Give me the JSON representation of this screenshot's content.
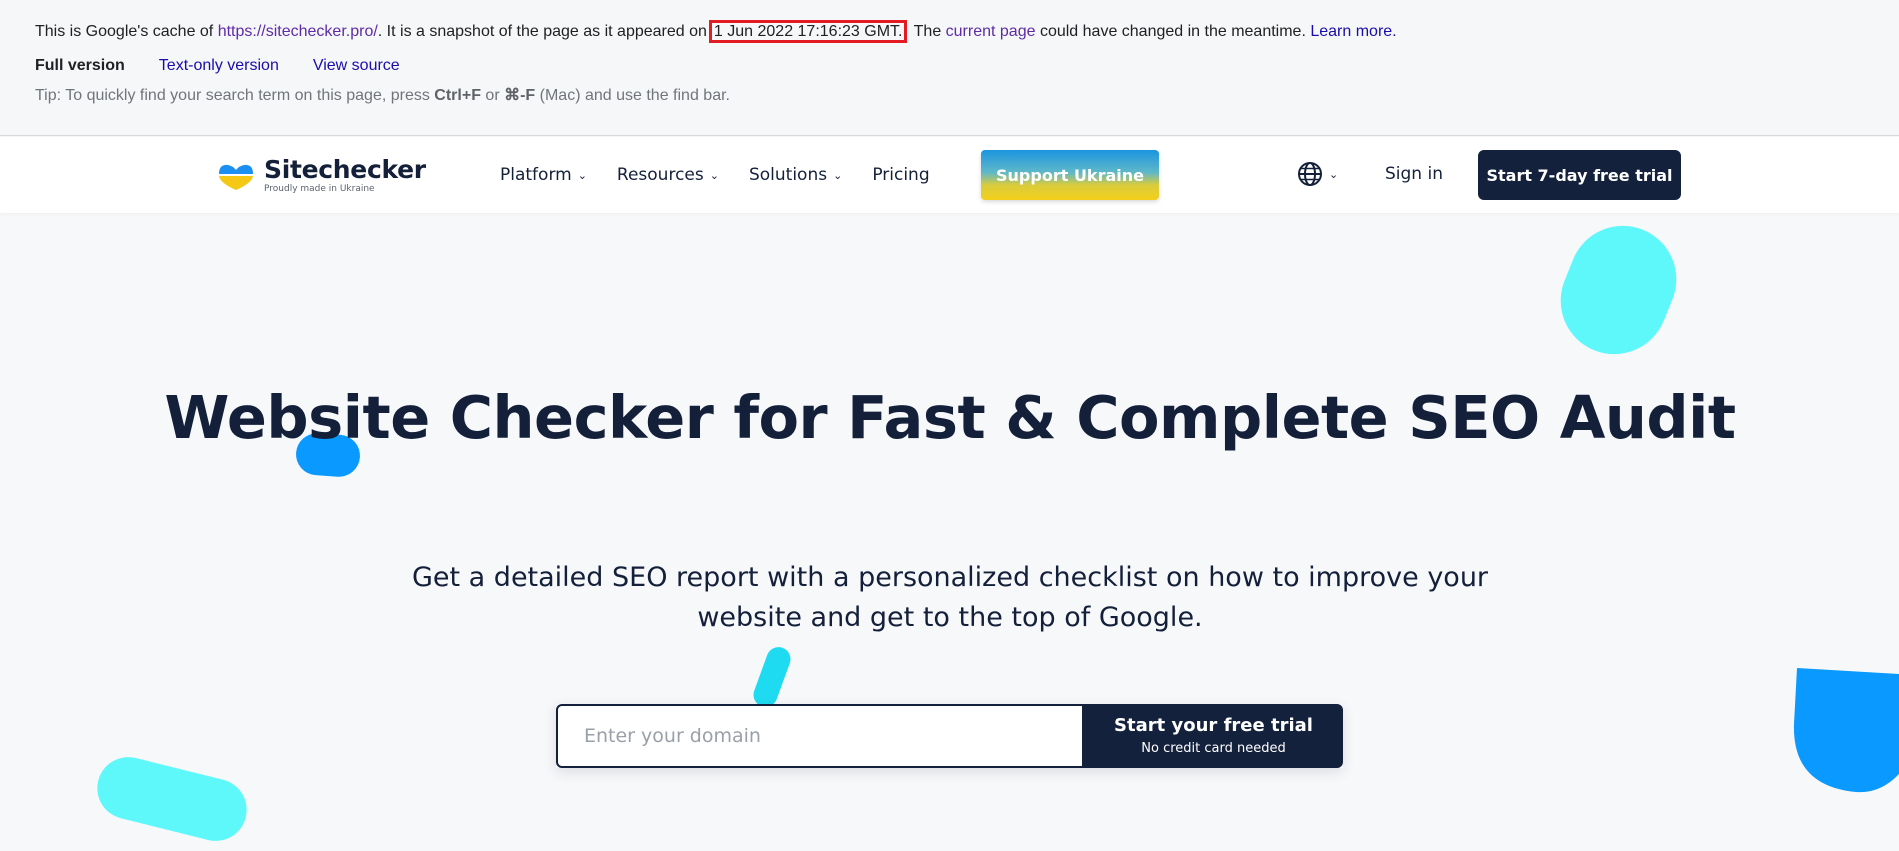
{
  "cache_banner": {
    "prefix": "This is Google's cache of ",
    "url": "https://sitechecker.pro/",
    "middle": ". It is a snapshot of the page as it appeared on",
    "date": "1 Jun 2022 17:16:23 GMT.",
    "the": " The ",
    "current_page": "current page",
    "suffix": " could have changed in the meantime. ",
    "learn_more": "Learn more.",
    "full_version": "Full version",
    "text_only": "Text-only version",
    "view_source": "View source",
    "tip_prefix": "Tip: To quickly find your search term on this page, press ",
    "tip_key1": "Ctrl+F",
    "tip_or": " or ",
    "tip_key2": "⌘-F",
    "tip_suffix": " (Mac) and use the find bar."
  },
  "header": {
    "logo_name": "Sitechecker",
    "logo_tagline": "Proudly made in Ukraine",
    "nav": [
      {
        "label": "Platform",
        "has_dropdown": true
      },
      {
        "label": "Resources",
        "has_dropdown": true
      },
      {
        "label": "Solutions",
        "has_dropdown": true
      },
      {
        "label": "Pricing",
        "has_dropdown": false
      }
    ],
    "support_label": "Support Ukraine",
    "sign_in": "Sign in",
    "trial_label": "Start 7-day free trial",
    "chevron": "⌄",
    "icons": {
      "language": "globe-icon",
      "dropdown": "chevron-down-icon"
    }
  },
  "hero": {
    "title": "Website Checker for Fast & Complete SEO Audit",
    "subtitle": "Get a detailed SEO report with a personalized checklist on how to improve your website and get to the top of Google.",
    "input_placeholder": "Enter your domain",
    "submit_label": "Start your free trial",
    "submit_note": "No credit card needed"
  },
  "colors": {
    "navy": "#14213d",
    "cyan": "#5ef8fb",
    "blue": "#0a99ff",
    "link_purple": "#5e2ca5",
    "link_blue": "#1a0dab",
    "highlight_red": "#e31b23"
  }
}
